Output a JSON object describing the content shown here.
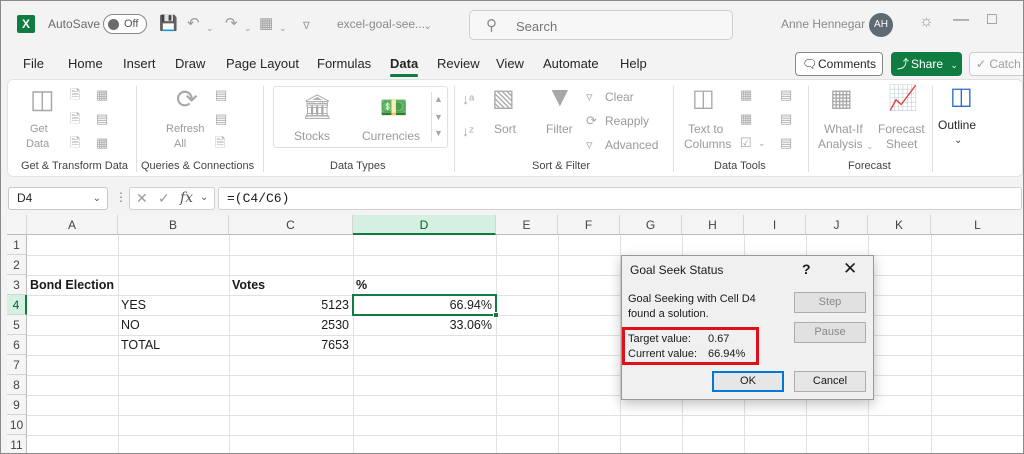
{
  "titlebar": {
    "autosave_label": "AutoSave",
    "autosave_state": "Off",
    "doc_title": "excel-goal-see...",
    "search_placeholder": "Search",
    "user_name": "Anne Hennegar",
    "user_initials": "AH"
  },
  "menu": {
    "tabs": [
      "File",
      "Home",
      "Insert",
      "Draw",
      "Page Layout",
      "Formulas",
      "Data",
      "Review",
      "View",
      "Automate",
      "Help"
    ],
    "active": "Data",
    "comments_label": "Comments",
    "share_label": "Share",
    "catch_label": "Catch"
  },
  "ribbon": {
    "groups": [
      "Get & Transform Data",
      "Queries & Connections",
      "Data Types",
      "Sort & Filter",
      "Data Tools",
      "Forecast"
    ],
    "get_data": [
      "Get",
      "Data"
    ],
    "refresh_all": [
      "Refresh",
      "All"
    ],
    "stocks": "Stocks",
    "currencies": "Currencies",
    "sort": "Sort",
    "filter": "Filter",
    "clear": "Clear",
    "reapply": "Reapply",
    "advanced": "Advanced",
    "text_to_columns": [
      "Text to",
      "Columns"
    ],
    "what_if": [
      "What-If",
      "Analysis"
    ],
    "forecast_sheet": [
      "Forecast",
      "Sheet"
    ],
    "outline": "Outline"
  },
  "formula_bar": {
    "name_box": "D4",
    "formula": "=(C4/C6)"
  },
  "sheet": {
    "columns": [
      "A",
      "B",
      "C",
      "D",
      "E",
      "F",
      "G",
      "H",
      "I",
      "J",
      "K",
      "L"
    ],
    "selected_column": "D",
    "rows": [
      "1",
      "2",
      "3",
      "4",
      "5",
      "6",
      "7",
      "8",
      "9",
      "10",
      "11"
    ],
    "selected_row": "4",
    "cells": {
      "A3": "Bond Election",
      "C3": "Votes",
      "D3": "%",
      "B4": "YES",
      "C4": "5123",
      "D4": "66.94%",
      "B5": "NO",
      "C5": "2530",
      "D5": "33.06%",
      "B6": "TOTAL",
      "C6": "7653"
    }
  },
  "dialog": {
    "title": "Goal Seek Status",
    "help": "?",
    "message": "Goal Seeking with Cell D4 found a solution.",
    "target_label": "Target value:",
    "target_value": "0.67",
    "current_label": "Current value:",
    "current_value": "66.94%",
    "step_label": "Step",
    "pause_label": "Pause",
    "ok_label": "OK",
    "cancel_label": "Cancel",
    "highlight_color": "#e0101a"
  },
  "colors": {
    "accent": "#107c41",
    "selection_header": "#d3f0e0",
    "ok_focus": "#0078d7"
  }
}
